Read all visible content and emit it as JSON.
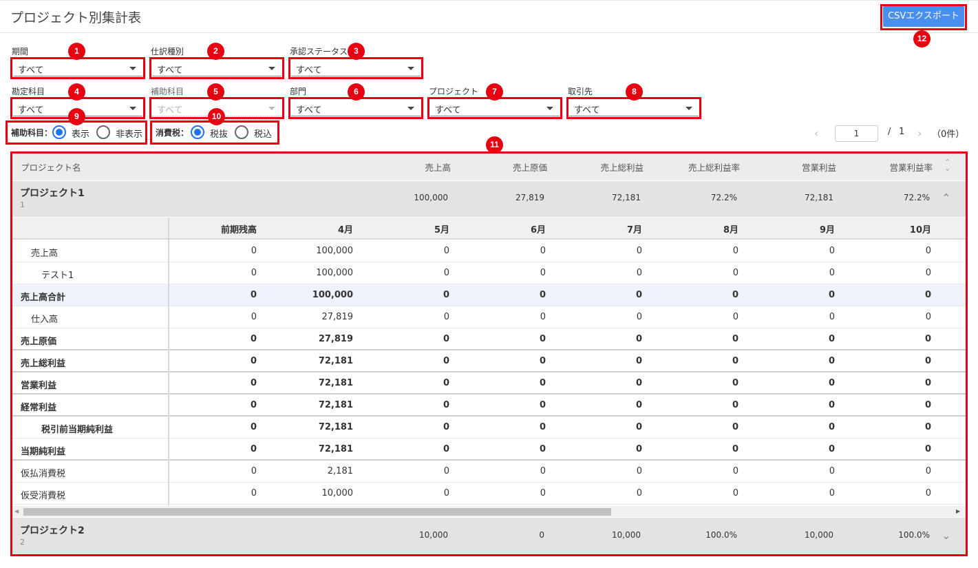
{
  "page_title": "プロジェクト別集計表",
  "export_button": "CSVエクスポート",
  "badges": [
    "1",
    "2",
    "3",
    "4",
    "5",
    "6",
    "7",
    "8",
    "9",
    "10",
    "11",
    "12"
  ],
  "filters": {
    "period": {
      "label": "期間",
      "value": "すべて"
    },
    "journal_type": {
      "label": "仕訳種別",
      "value": "すべて"
    },
    "approval_status": {
      "label": "承認ステータス",
      "value": "すべて"
    },
    "account": {
      "label": "勘定科目",
      "value": "すべて"
    },
    "sub_account": {
      "label": "補助科目",
      "value": "すべて"
    },
    "department": {
      "label": "部門",
      "value": "すべて"
    },
    "project": {
      "label": "プロジェクト",
      "value": "すべて"
    },
    "client": {
      "label": "取引先",
      "value": "すべて"
    }
  },
  "sub_account_display": {
    "label": "補助科目：",
    "options": [
      "表示",
      "非表示"
    ],
    "selected": "表示"
  },
  "tax": {
    "label": "消費税：",
    "options": [
      "税抜",
      "税込"
    ],
    "selected": "税抜"
  },
  "pagination": {
    "current": "1",
    "separator": "/",
    "total": "1",
    "count": "（0件）"
  },
  "summary_headers": [
    "プロジェクト名",
    "売上高",
    "売上原価",
    "売上総利益",
    "売上総利益率",
    "営業利益",
    "営業利益率"
  ],
  "projects": [
    {
      "name": "プロジェクト1",
      "code": "1",
      "values": [
        "100,000",
        "27,819",
        "72,181",
        "72.2%",
        "72,181",
        "72.2%"
      ]
    },
    {
      "name": "プロジェクト2",
      "code": "2",
      "values": [
        "10,000",
        "0",
        "10,000",
        "100.0%",
        "10,000",
        "100.0%"
      ]
    }
  ],
  "detail_headers": [
    "前期残高",
    "4月",
    "5月",
    "6月",
    "7月",
    "8月",
    "9月",
    "10月"
  ],
  "detail_rows": [
    {
      "label": "売上高",
      "indent": 1,
      "bold": false,
      "values": [
        "0",
        "100,000",
        "0",
        "0",
        "0",
        "0",
        "0",
        "0"
      ]
    },
    {
      "label": "テスト1",
      "indent": 2,
      "bold": false,
      "values": [
        "0",
        "100,000",
        "0",
        "0",
        "0",
        "0",
        "0",
        "0"
      ]
    },
    {
      "label": "売上高合計",
      "indent": 0,
      "bold": true,
      "highlight": true,
      "values": [
        "0",
        "100,000",
        "0",
        "0",
        "0",
        "0",
        "0",
        "0"
      ]
    },
    {
      "label": "仕入高",
      "indent": 1,
      "bold": false,
      "values": [
        "0",
        "27,819",
        "0",
        "0",
        "0",
        "0",
        "0",
        "0"
      ]
    },
    {
      "label": "売上原価",
      "indent": 0,
      "bold": true,
      "values": [
        "0",
        "27,819",
        "0",
        "0",
        "0",
        "0",
        "0",
        "0"
      ]
    },
    {
      "label": "売上総利益",
      "indent": 0,
      "bold": true,
      "values": [
        "0",
        "72,181",
        "0",
        "0",
        "0",
        "0",
        "0",
        "0"
      ]
    },
    {
      "label": "営業利益",
      "indent": 0,
      "bold": true,
      "values": [
        "0",
        "72,181",
        "0",
        "0",
        "0",
        "0",
        "0",
        "0"
      ]
    },
    {
      "label": "経常利益",
      "indent": 0,
      "bold": true,
      "values": [
        "0",
        "72,181",
        "0",
        "0",
        "0",
        "0",
        "0",
        "0"
      ]
    },
    {
      "label": "税引前当期純利益",
      "indent": 2,
      "bold": true,
      "values": [
        "0",
        "72,181",
        "0",
        "0",
        "0",
        "0",
        "0",
        "0"
      ]
    },
    {
      "label": "当期純利益",
      "indent": 0,
      "bold": true,
      "values": [
        "0",
        "72,181",
        "0",
        "0",
        "0",
        "0",
        "0",
        "0"
      ]
    },
    {
      "label": "仮払消費税",
      "indent": 0,
      "bold": false,
      "values": [
        "0",
        "2,181",
        "0",
        "0",
        "0",
        "0",
        "0",
        "0"
      ]
    },
    {
      "label": "仮受消費税",
      "indent": 0,
      "bold": false,
      "values": [
        "0",
        "10,000",
        "0",
        "0",
        "0",
        "0",
        "0",
        "0"
      ]
    }
  ]
}
